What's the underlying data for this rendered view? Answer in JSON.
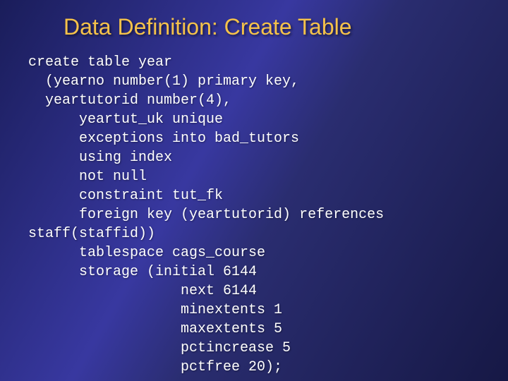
{
  "title": "Data Definition: Create Table",
  "code": {
    "l1": "create table year",
    "l2": "  (yearno number(1) primary key,",
    "l3": "  yeartutorid number(4),",
    "l4": "      yeartut_uk unique",
    "l5": "      exceptions into bad_tutors",
    "l6": "      using index",
    "l7": "      not null",
    "l8": "      constraint tut_fk",
    "l9": "      foreign key (yeartutorid) references",
    "l10": "staff(staffid))",
    "l11": "      tablespace cags_course",
    "l12": "      storage (initial 6144",
    "l13": "                  next 6144",
    "l14": "                  minextents 1",
    "l15": "                  maxextents 5",
    "l16": "                  pctincrease 5",
    "l17": "                  pctfree 20);"
  }
}
